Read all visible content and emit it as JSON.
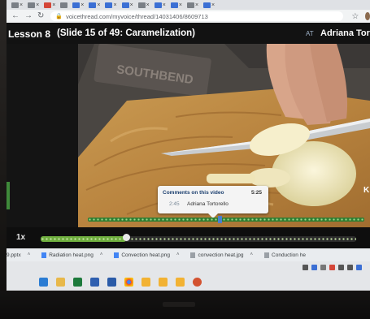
{
  "browser": {
    "url": "voicethread.com/myvoice/thread/14031406/8609713",
    "tabs_close_glyph": "×"
  },
  "header": {
    "lesson": "Lesson 8",
    "slide": "(Slide 15 of 49: Caramelization)",
    "badge": "AT",
    "author": "Adriana Tortor"
  },
  "video": {
    "brand_text": "SOUTHBEND",
    "side_text": "K"
  },
  "comment_popup": {
    "title": "Comments on this video",
    "duration": "5:25",
    "comment_time": "2:45",
    "commenter": "Adriana Tortorello"
  },
  "player": {
    "speed": "1x",
    "played_fraction": 0.27
  },
  "downloads": [
    {
      "name": "9.pptx"
    },
    {
      "name": "Radiation heat.png"
    },
    {
      "name": "Convection heat.png"
    },
    {
      "name": "convection heat.jpg"
    },
    {
      "name": "Conduction he"
    }
  ],
  "colors": {
    "progress": "#6fae3f",
    "header_bg": "#121212"
  }
}
